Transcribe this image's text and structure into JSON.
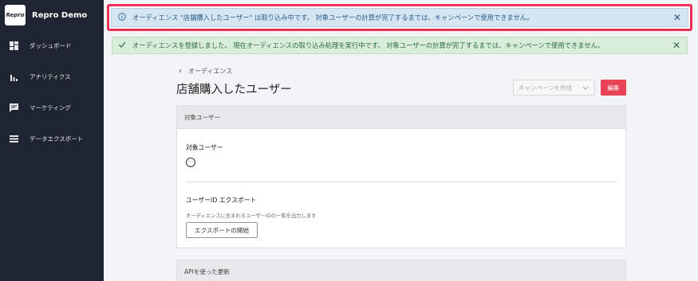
{
  "app": {
    "name": "Repro Demo",
    "logo_text": "Repro"
  },
  "sidebar": {
    "items": [
      {
        "label": "ダッシュボード",
        "icon": "dashboard-icon"
      },
      {
        "label": "アナリティクス",
        "icon": "bar-chart-icon"
      },
      {
        "label": "マーケティング",
        "icon": "chat-icon"
      },
      {
        "label": "データエクスポート",
        "icon": "list-icon"
      }
    ]
  },
  "alerts": {
    "info": {
      "text": "オーディエンス \"店舗購入したユーザー\" は取り込み中です。 対象ユーザーの計算が完了するまでは、キャンペーンで使用できません。",
      "close": "✕"
    },
    "success": {
      "text": "オーディエンスを登録しました。 現在オーディエンスの取り込み処理を実行中です。 対象ユーザーの計算が完了するまでは、キャンペーンで使用できません。",
      "close": "✕"
    }
  },
  "page": {
    "breadcrumb": "オーディエンス",
    "title": "店舗購入したユーザー",
    "create_campaign_label": "キャンペーンを作成",
    "edit_label": "編集"
  },
  "card_target": {
    "header": "対象ユーザー",
    "target_users_label": "対象ユーザー",
    "export_title": "ユーザーID エクスポート",
    "export_help": "オーディエンスに含まれるユーザーIDの一覧を出力します",
    "export_button": "エクスポートの開始"
  },
  "card_api": {
    "header": "APIを使った更新"
  },
  "colors": {
    "sidebar_bg": "#1f2530",
    "accent": "#e84356",
    "highlight": "#ee2f5a",
    "info_bg": "#d5e5f2",
    "success_bg": "#d9eddb"
  }
}
